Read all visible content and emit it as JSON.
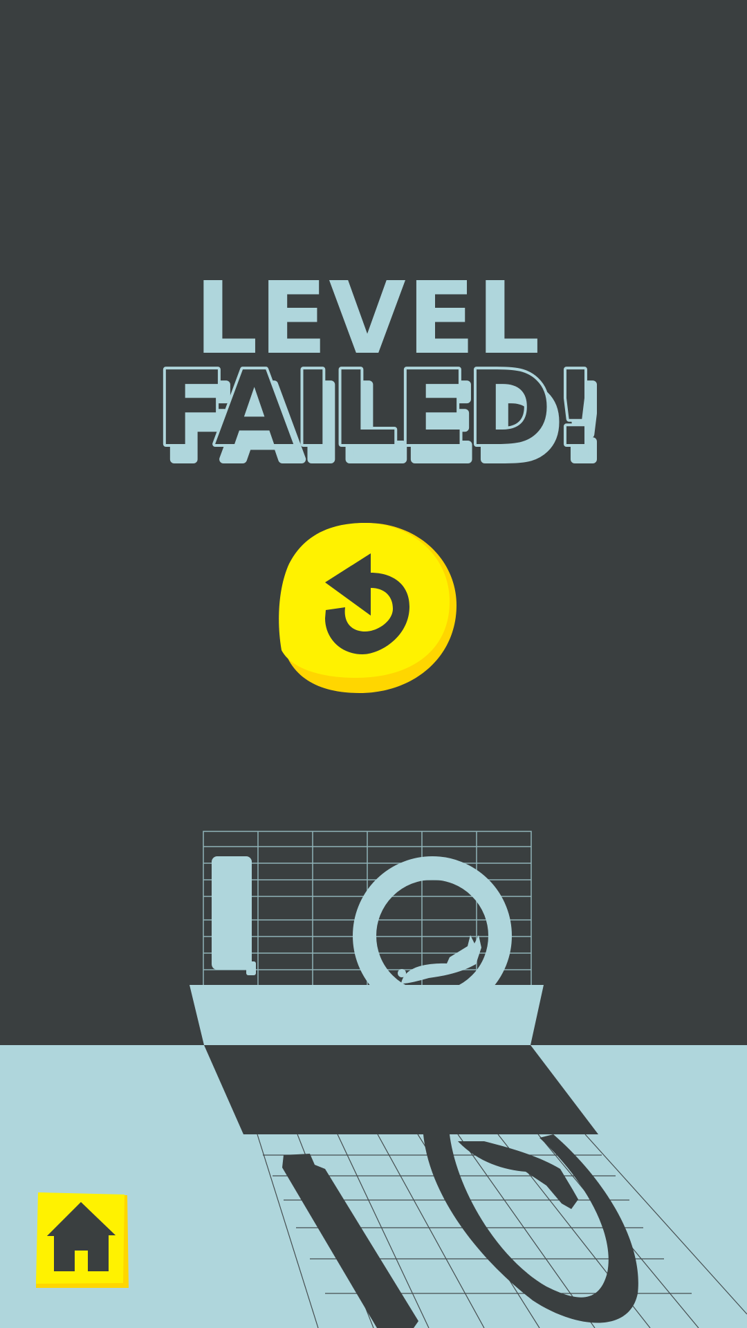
{
  "title": {
    "line1": "LEVEL",
    "line2": "FAILED!"
  },
  "buttons": {
    "retry_icon": "retry-arrow-icon",
    "home_icon": "home-icon"
  },
  "colors": {
    "background": "#3a3f40",
    "accent": "#afd6dc",
    "button_yellow": "#fff200",
    "button_shade": "#ffd600"
  }
}
